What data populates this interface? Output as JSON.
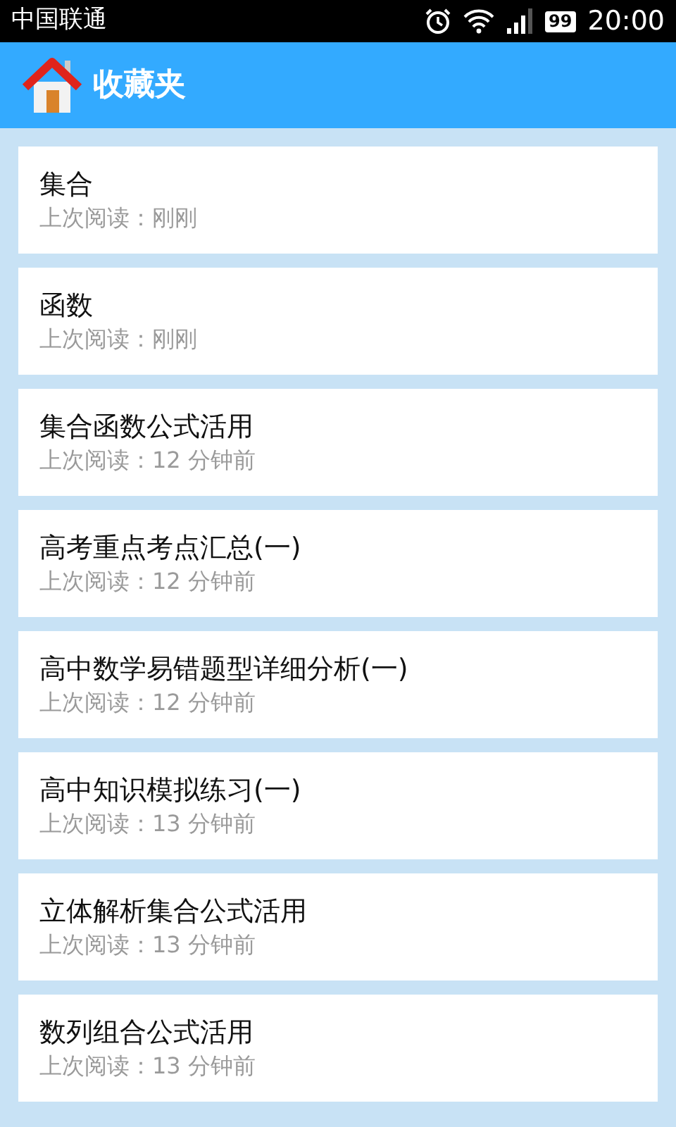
{
  "status_bar": {
    "carrier": "中国联通",
    "battery": "99",
    "time": "20:00"
  },
  "header": {
    "title": "收藏夹"
  },
  "favorites": [
    {
      "title": "集合",
      "last_read": "上次阅读：刚刚"
    },
    {
      "title": "函数",
      "last_read": "上次阅读：刚刚"
    },
    {
      "title": "集合函数公式活用",
      "last_read": "上次阅读：12 分钟前"
    },
    {
      "title": "高考重点考点汇总(一)",
      "last_read": "上次阅读：12 分钟前"
    },
    {
      "title": "高中数学易错题型详细分析(一)",
      "last_read": "上次阅读：12 分钟前"
    },
    {
      "title": "高中知识模拟练习(一)",
      "last_read": "上次阅读：13 分钟前"
    },
    {
      "title": "立体解析集合公式活用",
      "last_read": "上次阅读：13 分钟前"
    },
    {
      "title": "数列组合公式活用",
      "last_read": "上次阅读：13 分钟前"
    }
  ]
}
